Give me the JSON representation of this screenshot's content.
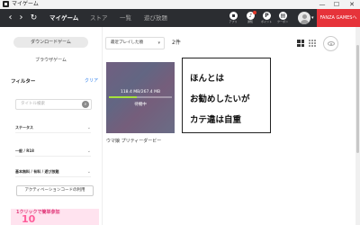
{
  "window": {
    "title": "マイゲーム",
    "controls": {
      "minimize": "—",
      "maximize": "☐",
      "close": "✕"
    }
  },
  "header": {
    "nav": {
      "back": "‹",
      "forward": "›",
      "reload": "↻"
    },
    "tabs": [
      {
        "label": "マイゲーム",
        "active": true
      },
      {
        "label": "ストア",
        "active": false
      },
      {
        "label": "一覧",
        "active": false
      },
      {
        "label": "遊び放題",
        "active": false
      }
    ],
    "icons": [
      {
        "name": "apps-icon",
        "caption": "アプリ"
      },
      {
        "name": "notification-bell-icon",
        "caption": "通知"
      },
      {
        "name": "point-icon",
        "caption": "ポイント"
      },
      {
        "name": "coupon-icon",
        "caption": "クーポン"
      }
    ],
    "account_caret": "▾",
    "fanza_button": "FANZA GAMESへ"
  },
  "sidebar": {
    "download_games": "ダウンロードゲーム",
    "browser_games": "ブラウザゲーム",
    "filter_label": "フィルター",
    "clear_label": "クリア",
    "search_placeholder": "タイトル検索",
    "filters": [
      {
        "label": "ステータス"
      },
      {
        "label": "一般 / R18"
      },
      {
        "label": "基本無料 / 有料 / 遊び放題"
      }
    ],
    "activation_code_button": "アクティベーションコードの利用",
    "banner": {
      "text": "1クリックで簡単参加",
      "big": "10"
    }
  },
  "main": {
    "sort_value": "最近プレイした順",
    "sort_caret": "▾",
    "count_text": "2件",
    "games": [
      {
        "title": "ウマ娘 プリティーダービー",
        "download_size": "118.4 MB/267.4 MB",
        "status": "待機中",
        "progress": 0.44
      }
    ]
  },
  "overlay_note": {
    "lines": [
      "ほんとは",
      "お勧めしたいが",
      "カテ違は自重"
    ]
  },
  "colors": {
    "header_bg": "#2b2d31",
    "fanza_red": "#e6333a",
    "clear_blue": "#2f80ed",
    "progress_green": "#a6e13c"
  }
}
